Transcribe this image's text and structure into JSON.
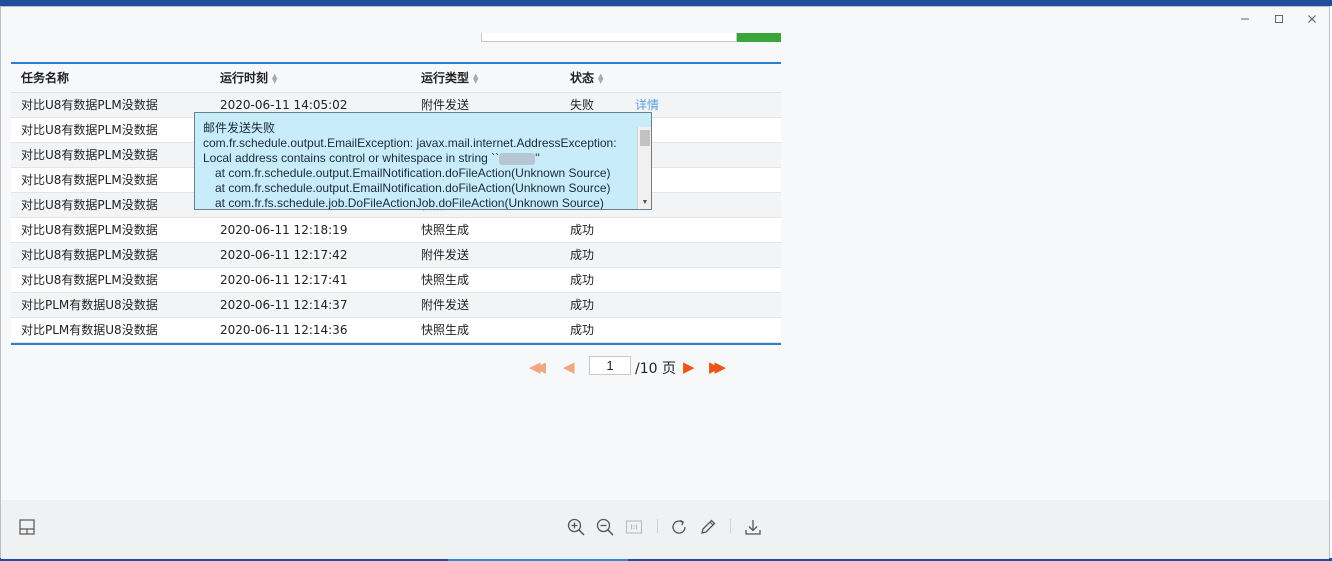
{
  "window": {
    "minimize_icon": "minimize-icon",
    "maximize_icon": "maximize-icon",
    "close_icon": "close-icon"
  },
  "table": {
    "columns": [
      {
        "label": "任务名称",
        "sortable": false
      },
      {
        "label": "运行时刻",
        "sortable": true
      },
      {
        "label": "运行类型",
        "sortable": true
      },
      {
        "label": "状态",
        "sortable": true
      }
    ],
    "rows": [
      {
        "name": "对比U8有数据PLM没数据",
        "time": "2020-06-11 14:05:02",
        "type": "附件发送",
        "status": "失败",
        "action": "详情"
      },
      {
        "name": "对比U8有数据PLM没数据",
        "time": "",
        "type": "",
        "status": "",
        "action": ""
      },
      {
        "name": "对比U8有数据PLM没数据",
        "time": "",
        "type": "",
        "status": "",
        "action": ""
      },
      {
        "name": "对比U8有数据PLM没数据",
        "time": "",
        "type": "",
        "status": "",
        "action": ""
      },
      {
        "name": "对比U8有数据PLM没数据",
        "time": "2020-06-11 12:18:19",
        "type": "快照生成",
        "status": "成功",
        "action": ""
      },
      {
        "name": "对比U8有数据PLM没数据",
        "time": "2020-06-11 12:18:19",
        "type": "快照生成",
        "status": "成功",
        "action": ""
      },
      {
        "name": "对比U8有数据PLM没数据",
        "time": "2020-06-11 12:17:42",
        "type": "附件发送",
        "status": "成功",
        "action": ""
      },
      {
        "name": "对比U8有数据PLM没数据",
        "time": "2020-06-11 12:17:41",
        "type": "快照生成",
        "status": "成功",
        "action": ""
      },
      {
        "name": "对比PLM有数据U8没数据",
        "time": "2020-06-11 12:14:37",
        "type": "附件发送",
        "status": "成功",
        "action": ""
      },
      {
        "name": "对比PLM有数据U8没数据",
        "time": "2020-06-11 12:14:36",
        "type": "快照生成",
        "status": "成功",
        "action": ""
      }
    ]
  },
  "tooltip": {
    "title": "邮件发送失败",
    "line1": "com.fr.schedule.output.EmailException: javax.mail.internet.AddressException:",
    "line2_prefix": "Local address contains control or whitespace in string ``",
    "line2_suffix": "''",
    "line3": "at com.fr.schedule.output.EmailNotification.doFileAction(Unknown Source)",
    "line4": "at com.fr.schedule.output.EmailNotification.doFileAction(Unknown Source)",
    "line5": "at com.fr.fs.schedule.job.DoFileActionJob.doFileAction(Unknown Source)"
  },
  "pager": {
    "current_page": "1",
    "total_label": "/10 页"
  },
  "colors": {
    "accent_blue": "#2f7fd0",
    "tooltip_bg": "#c9ecfb",
    "pager_active": "#e8561a",
    "pager_disabled": "#f0a882",
    "link": "#5aa0e0"
  }
}
